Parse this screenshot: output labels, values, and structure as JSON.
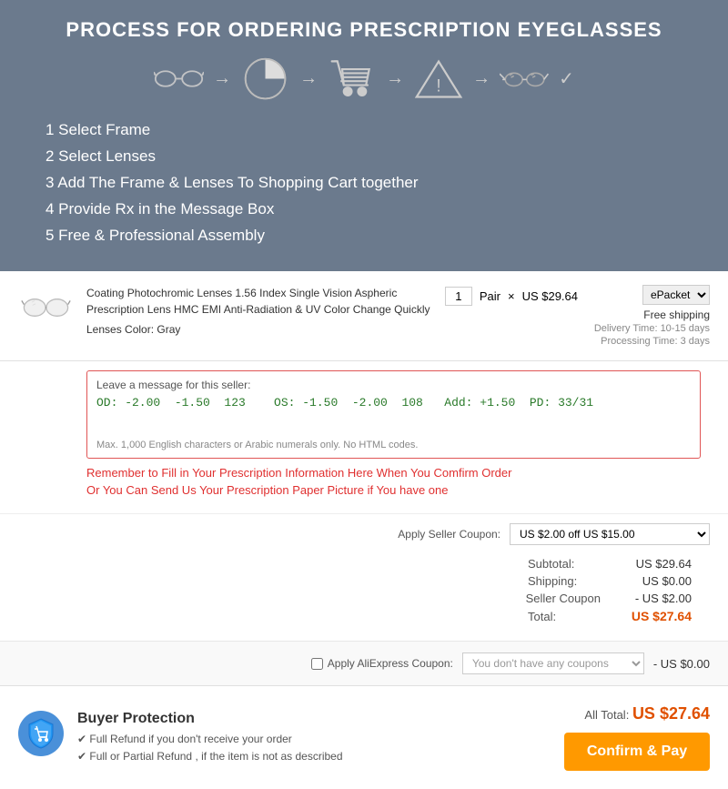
{
  "header": {
    "title": "PROCESS FOR ORDERING PRESCRIPTION EYEGLASSES",
    "steps": [
      "1 Select Frame",
      "2 Select Lenses",
      "3 Add The Frame & Lenses To Shopping Cart together",
      "4 Provide Rx in the Message Box",
      "5 Free & Professional Assembly"
    ]
  },
  "product": {
    "name": "Coating Photochromic Lenses 1.56 Index Single Vision Aspheric Prescription Lens HMC EMI Anti-Radiation & UV Color Change Quickly",
    "lenses_color_label": "Lenses Color:",
    "lenses_color_value": "Gray",
    "quantity": "1",
    "unit": "Pair",
    "price": "US $29.64",
    "shipping_option": "ePacket",
    "shipping_free": "Free shipping",
    "delivery_time": "Delivery Time: 10-15 days",
    "processing_time": "Processing Time: 3 days"
  },
  "message_box": {
    "label": "Leave a message for this seller:",
    "content": "OD: -2.00  -1.50  123    OS: -1.50  -2.00  108   Add: +1.50  PD: 33/31",
    "hint": "Max. 1,000 English characters or Arabic numerals only. No HTML codes.",
    "warning": "Remember to Fill in Your Prescription Information Here When You Comfirm Order",
    "alt_text": "Or You Can Send Us Your Prescription Paper Picture if You have one"
  },
  "coupon": {
    "label": "Apply Seller Coupon:",
    "value": "US $2.00 off US $15.00"
  },
  "totals": {
    "subtotal_label": "Subtotal:",
    "subtotal_value": "US $29.64",
    "shipping_label": "Shipping:",
    "shipping_value": "US $0.00",
    "seller_coupon_label": "Seller Coupon",
    "seller_coupon_value": "- US $2.00",
    "total_label": "Total:",
    "total_value": "US $27.64"
  },
  "aliexpress_coupon": {
    "apply_label": "Apply AliExpress Coupon:",
    "placeholder": "You don't have any coupons",
    "discount": "- US $0.00"
  },
  "buyer_protection": {
    "title": "Buyer Protection",
    "point1": "✔ Full Refund if you don't receive your order",
    "point2": "✔ Full or Partial Refund , if the item is not as described"
  },
  "footer": {
    "all_total_label": "All Total:",
    "all_total_value": "US $27.64",
    "confirm_button": "Confirm & Pay"
  }
}
